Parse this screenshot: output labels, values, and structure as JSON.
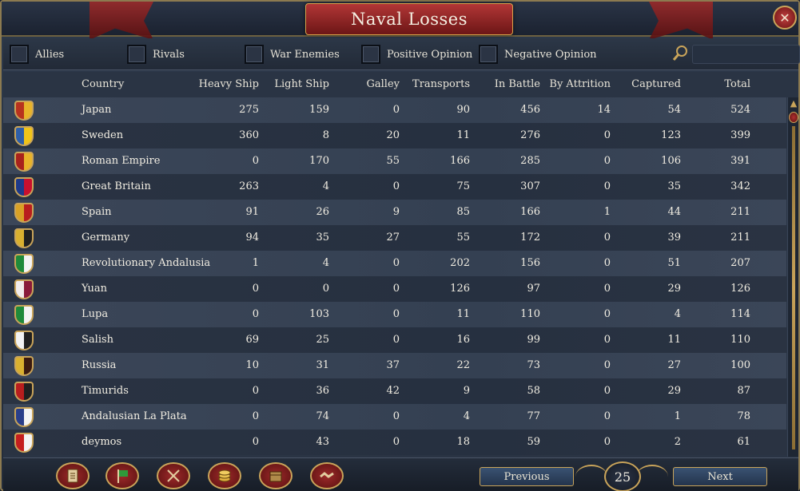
{
  "window": {
    "title": "Naval Losses"
  },
  "close_icon": "close-icon",
  "filters": [
    {
      "key": "allies",
      "label": "Allies"
    },
    {
      "key": "rivals",
      "label": "Rivals"
    },
    {
      "key": "war_enemies",
      "label": "War Enemies"
    },
    {
      "key": "positive_opinion",
      "label": "Positive Opinion"
    },
    {
      "key": "negative_opinion",
      "label": "Negative Opinion"
    }
  ],
  "search": {
    "icon": "search-icon",
    "value": ""
  },
  "table": {
    "headers": {
      "country": "Country",
      "heavy": "Heavy Ship",
      "light": "Light Ship",
      "galley": "Galley",
      "transports": "Transports",
      "in_battle": "In Battle",
      "attrition": "By Attrition",
      "captured": "Captured",
      "total": "Total"
    },
    "rows": [
      {
        "country": "Japan",
        "heavy": "275",
        "light": "159",
        "galley": "0",
        "transports": "90",
        "in_battle": "456",
        "attrition": "14",
        "captured": "54",
        "total": "524",
        "flag": "#b8321e",
        "flag2": "#e8b32a"
      },
      {
        "country": "Sweden",
        "heavy": "360",
        "light": "8",
        "galley": "20",
        "transports": "11",
        "in_battle": "276",
        "attrition": "0",
        "captured": "123",
        "total": "399",
        "flag": "#2f5fa8",
        "flag2": "#f0c419"
      },
      {
        "country": "Roman Empire",
        "heavy": "0",
        "light": "170",
        "galley": "55",
        "transports": "166",
        "in_battle": "285",
        "attrition": "0",
        "captured": "106",
        "total": "391",
        "flag": "#a8221c",
        "flag2": "#e8b32a"
      },
      {
        "country": "Great Britain",
        "heavy": "263",
        "light": "4",
        "galley": "0",
        "transports": "75",
        "in_battle": "307",
        "attrition": "0",
        "captured": "35",
        "total": "342",
        "flag": "#1e3a8a",
        "flag2": "#c8102e"
      },
      {
        "country": "Spain",
        "heavy": "91",
        "light": "26",
        "galley": "9",
        "transports": "85",
        "in_battle": "166",
        "attrition": "1",
        "captured": "44",
        "total": "211",
        "flag": "#d9a126",
        "flag2": "#b81e1e"
      },
      {
        "country": "Germany",
        "heavy": "94",
        "light": "35",
        "galley": "27",
        "transports": "55",
        "in_battle": "172",
        "attrition": "0",
        "captured": "39",
        "total": "211",
        "flag": "#d9b030",
        "flag2": "#202020"
      },
      {
        "country": "Revolutionary Andalusia",
        "heavy": "1",
        "light": "4",
        "galley": "0",
        "transports": "202",
        "in_battle": "156",
        "attrition": "0",
        "captured": "51",
        "total": "207",
        "flag": "#1f8a3a",
        "flag2": "#f4f4f4"
      },
      {
        "country": "Yuan",
        "heavy": "0",
        "light": "0",
        "galley": "0",
        "transports": "126",
        "in_battle": "97",
        "attrition": "0",
        "captured": "29",
        "total": "126",
        "flag": "#f2ecec",
        "flag2": "#8a1a3a"
      },
      {
        "country": "Lupa",
        "heavy": "0",
        "light": "103",
        "galley": "0",
        "transports": "11",
        "in_battle": "110",
        "attrition": "0",
        "captured": "4",
        "total": "114",
        "flag": "#1f8a3a",
        "flag2": "#f4f4f4"
      },
      {
        "country": "Salish",
        "heavy": "69",
        "light": "25",
        "galley": "0",
        "transports": "16",
        "in_battle": "99",
        "attrition": "0",
        "captured": "11",
        "total": "110",
        "flag": "#f2f2f2",
        "flag2": "#202020"
      },
      {
        "country": "Russia",
        "heavy": "10",
        "light": "31",
        "galley": "37",
        "transports": "22",
        "in_battle": "73",
        "attrition": "0",
        "captured": "27",
        "total": "100",
        "flag": "#d9b030",
        "flag2": "#3a1a10"
      },
      {
        "country": "Timurids",
        "heavy": "0",
        "light": "36",
        "galley": "42",
        "transports": "9",
        "in_battle": "58",
        "attrition": "0",
        "captured": "29",
        "total": "87",
        "flag": "#b81e1e",
        "flag2": "#202020"
      },
      {
        "country": "Andalusian La Plata",
        "heavy": "0",
        "light": "74",
        "galley": "0",
        "transports": "4",
        "in_battle": "77",
        "attrition": "0",
        "captured": "1",
        "total": "78",
        "flag": "#2a3f8a",
        "flag2": "#f4f4f4"
      },
      {
        "country": "deymos",
        "heavy": "0",
        "light": "43",
        "galley": "0",
        "transports": "18",
        "in_battle": "59",
        "attrition": "0",
        "captured": "2",
        "total": "61",
        "flag": "#c41e1e",
        "flag2": "#f4f4f4"
      }
    ]
  },
  "bottom": {
    "tabs": [
      "ledger-icon",
      "flag-icon",
      "crossed-swords-icon",
      "coins-icon",
      "trade-goods-icon",
      "handshake-icon"
    ],
    "previous_label": "Previous",
    "next_label": "Next",
    "page": "25"
  },
  "colors": {
    "accent_gold": "#c9a45a",
    "title_red": "#8a1e1e"
  }
}
